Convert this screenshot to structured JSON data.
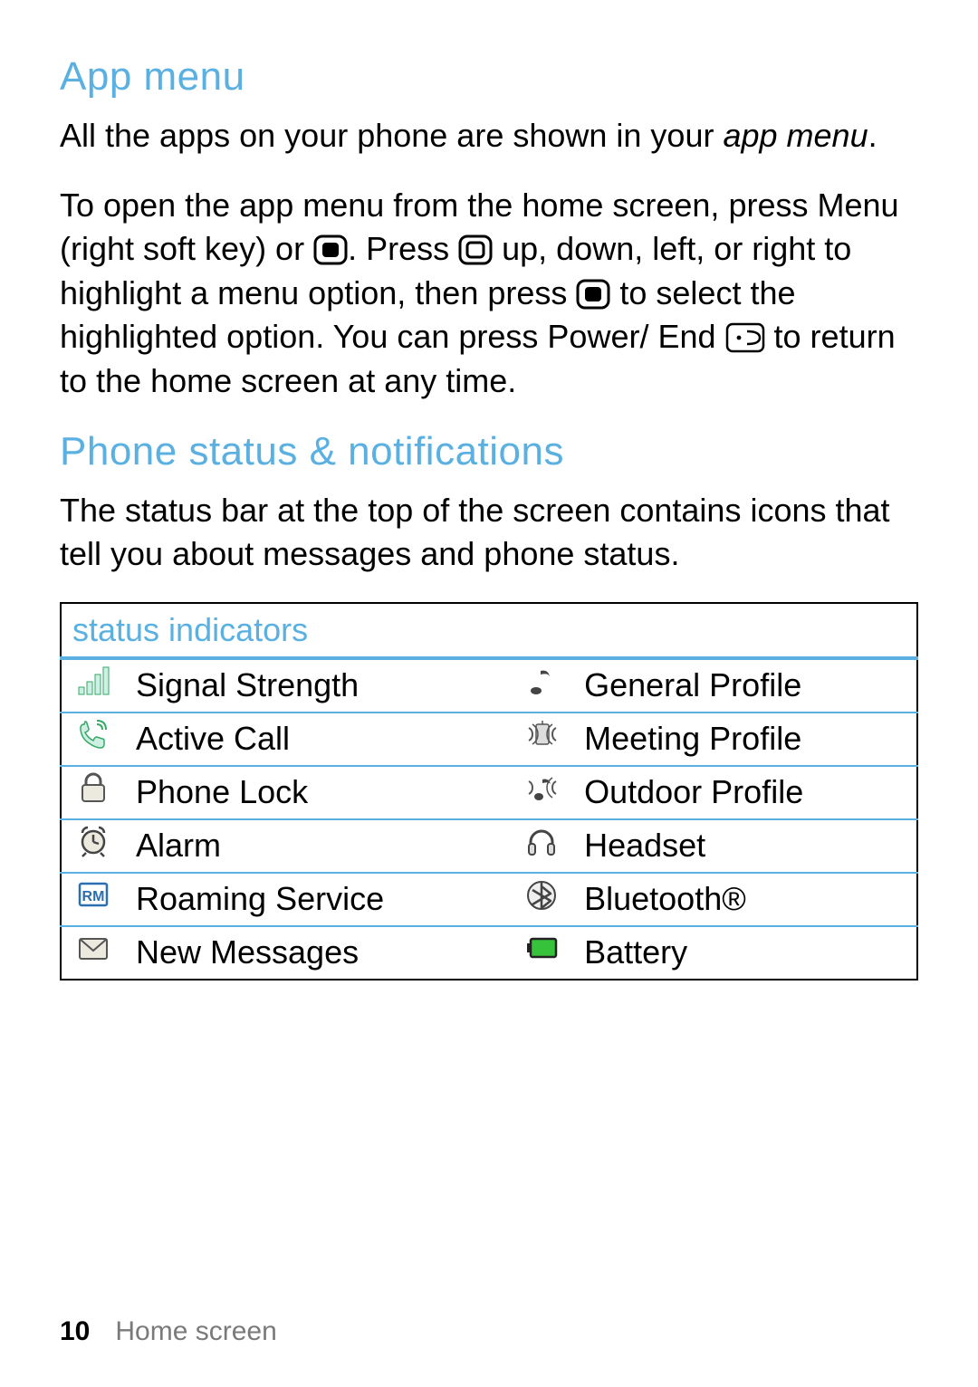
{
  "section1": {
    "heading": "App menu",
    "para1_a": "All the apps on your phone are shown in your ",
    "para1_b_italic": "app menu",
    "para1_c": ".",
    "para2_a": "To open the app menu from the home screen, press Menu (right soft key) or ",
    "para2_b": ". Press ",
    "para2_c": " up, down, left, or right to highlight a menu option, then press ",
    "para2_d": " to select the highlighted option. You can press Power/ End ",
    "para2_e": " to return to the home screen at any time."
  },
  "section2": {
    "heading": "Phone status & notifications",
    "para": "The status bar at the top of the screen contains icons that tell you about messages and phone status."
  },
  "status_table": {
    "header": "status indicators",
    "rows": [
      {
        "left_icon": "signal-icon",
        "left_label": "Signal Strength",
        "right_icon": "music-note-icon",
        "right_label": "General Profile"
      },
      {
        "left_icon": "active-call-icon",
        "left_label": "Active Call",
        "right_icon": "meeting-profile-icon",
        "right_label": "Meeting Profile"
      },
      {
        "left_icon": "lock-icon",
        "left_label": "Phone Lock",
        "right_icon": "outdoor-profile-icon",
        "right_label": "Outdoor Profile"
      },
      {
        "left_icon": "alarm-icon",
        "left_label": "Alarm",
        "right_icon": "headset-icon",
        "right_label": "Headset"
      },
      {
        "left_icon": "roaming-icon",
        "left_label": "Roaming Service",
        "right_icon": "bluetooth-icon",
        "right_label": "Bluetooth®"
      },
      {
        "left_icon": "envelope-icon",
        "left_label": "New Messages",
        "right_icon": "battery-icon",
        "right_label": "Battery"
      }
    ]
  },
  "footer": {
    "page_number": "10",
    "section_name": "Home screen"
  }
}
